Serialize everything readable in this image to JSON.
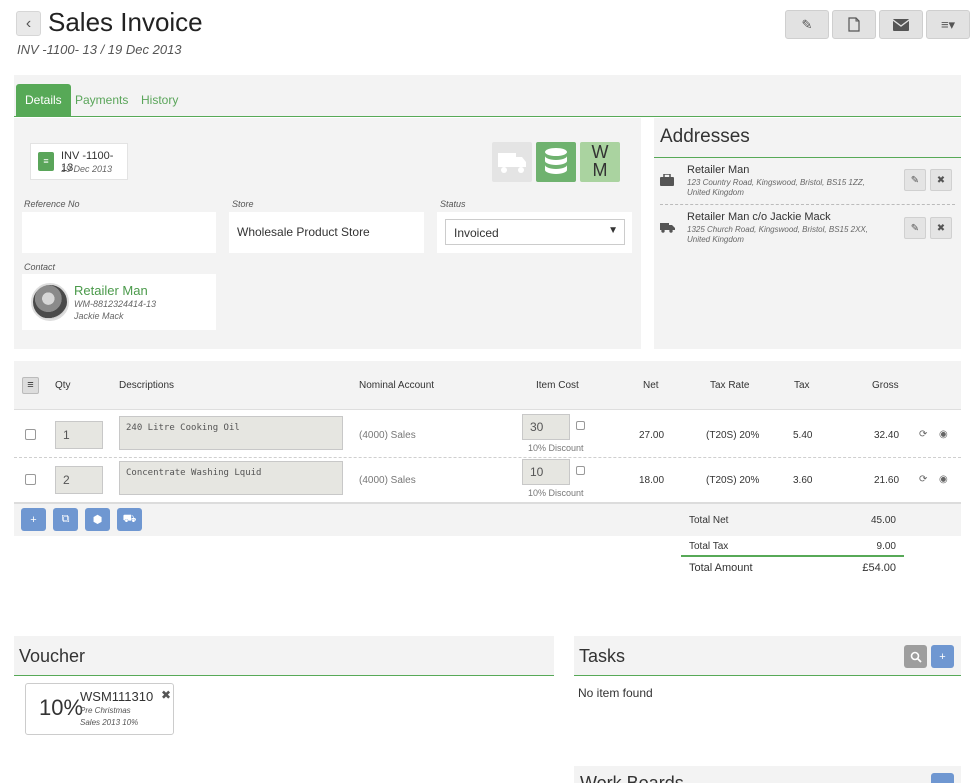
{
  "header": {
    "back_icon": "chevron-left-icon",
    "title": "Sales Invoice",
    "subtitle": "INV -1100- 13 / 19 Dec 2013",
    "actions": [
      {
        "icon": "pencil-icon",
        "glyph": "✎"
      },
      {
        "icon": "pdf-icon",
        "glyph": "⎘"
      },
      {
        "icon": "envelope-icon",
        "glyph": "✉"
      },
      {
        "icon": "menu-icon",
        "glyph": "≡▾"
      }
    ]
  },
  "tabs": [
    "Details",
    "Payments",
    "History"
  ],
  "invoice_card": {
    "number": "INV -1100- 13",
    "date": "19 Dec 2013"
  },
  "source_icons": {
    "wm_label_top": "W",
    "wm_label_bottom": "M"
  },
  "fields": {
    "reference_label": "Reference No",
    "reference_value": "",
    "store_label": "Store",
    "store_value": "Wholesale Product Store",
    "status_label": "Status",
    "status_value": "Invoiced",
    "contact_label": "Contact"
  },
  "contact": {
    "name": "Retailer Man",
    "code": "WM-8812324414-13",
    "person": "Jackie Mack"
  },
  "addresses": {
    "title": "Addresses",
    "items": [
      {
        "icon": "briefcase-icon",
        "name": "Retailer Man",
        "line1": "123 Country Road, Kingswood, Bristol, BS15 1ZZ,",
        "line2": "United Kingdom"
      },
      {
        "icon": "truck-icon",
        "name": "Retailer Man c/o Jackie Mack",
        "line1": "1325 Church Road, Kingswood, Bristol, BS15 2XX,",
        "line2": "United Kingdom"
      }
    ]
  },
  "table": {
    "headers": {
      "qty": "Qty",
      "desc": "Descriptions",
      "nominal": "Nominal Account",
      "cost": "Item Cost",
      "net": "Net",
      "rate": "Tax Rate",
      "tax": "Tax",
      "gross": "Gross"
    },
    "rows": [
      {
        "qty": "1",
        "description": "240 Litre Cooking Oil",
        "nominal": "(4000) Sales",
        "cost": "30",
        "discount": "10% Discount",
        "net": "27.00",
        "rate": "(T20S) 20%",
        "tax": "5.40",
        "gross": "32.40"
      },
      {
        "qty": "2",
        "description": "Concentrate Washing Lquid",
        "nominal": "(4000) Sales",
        "cost": "10",
        "discount": "10% Discount",
        "net": "18.00",
        "rate": "(T20S) 20%",
        "tax": "3.60",
        "gross": "21.60"
      }
    ]
  },
  "totals": {
    "net_label": "Total Net",
    "net_value": "45.00",
    "tax_label": "Total Tax",
    "tax_value": "9.00",
    "amount_label": "Total Amount",
    "amount_value": "£54.00"
  },
  "voucher": {
    "title": "Voucher",
    "percent": "10%",
    "code": "WSM111310",
    "desc1": "Pre Christmas",
    "desc2": "Sales 2013 10%"
  },
  "tasks": {
    "title": "Tasks",
    "empty": "No item found"
  },
  "work_boards": {
    "title": "Work Boards"
  },
  "colors": {
    "accent": "#57a957",
    "button_blue": "#6f97d1",
    "panel_bg": "#f3f3f3"
  }
}
